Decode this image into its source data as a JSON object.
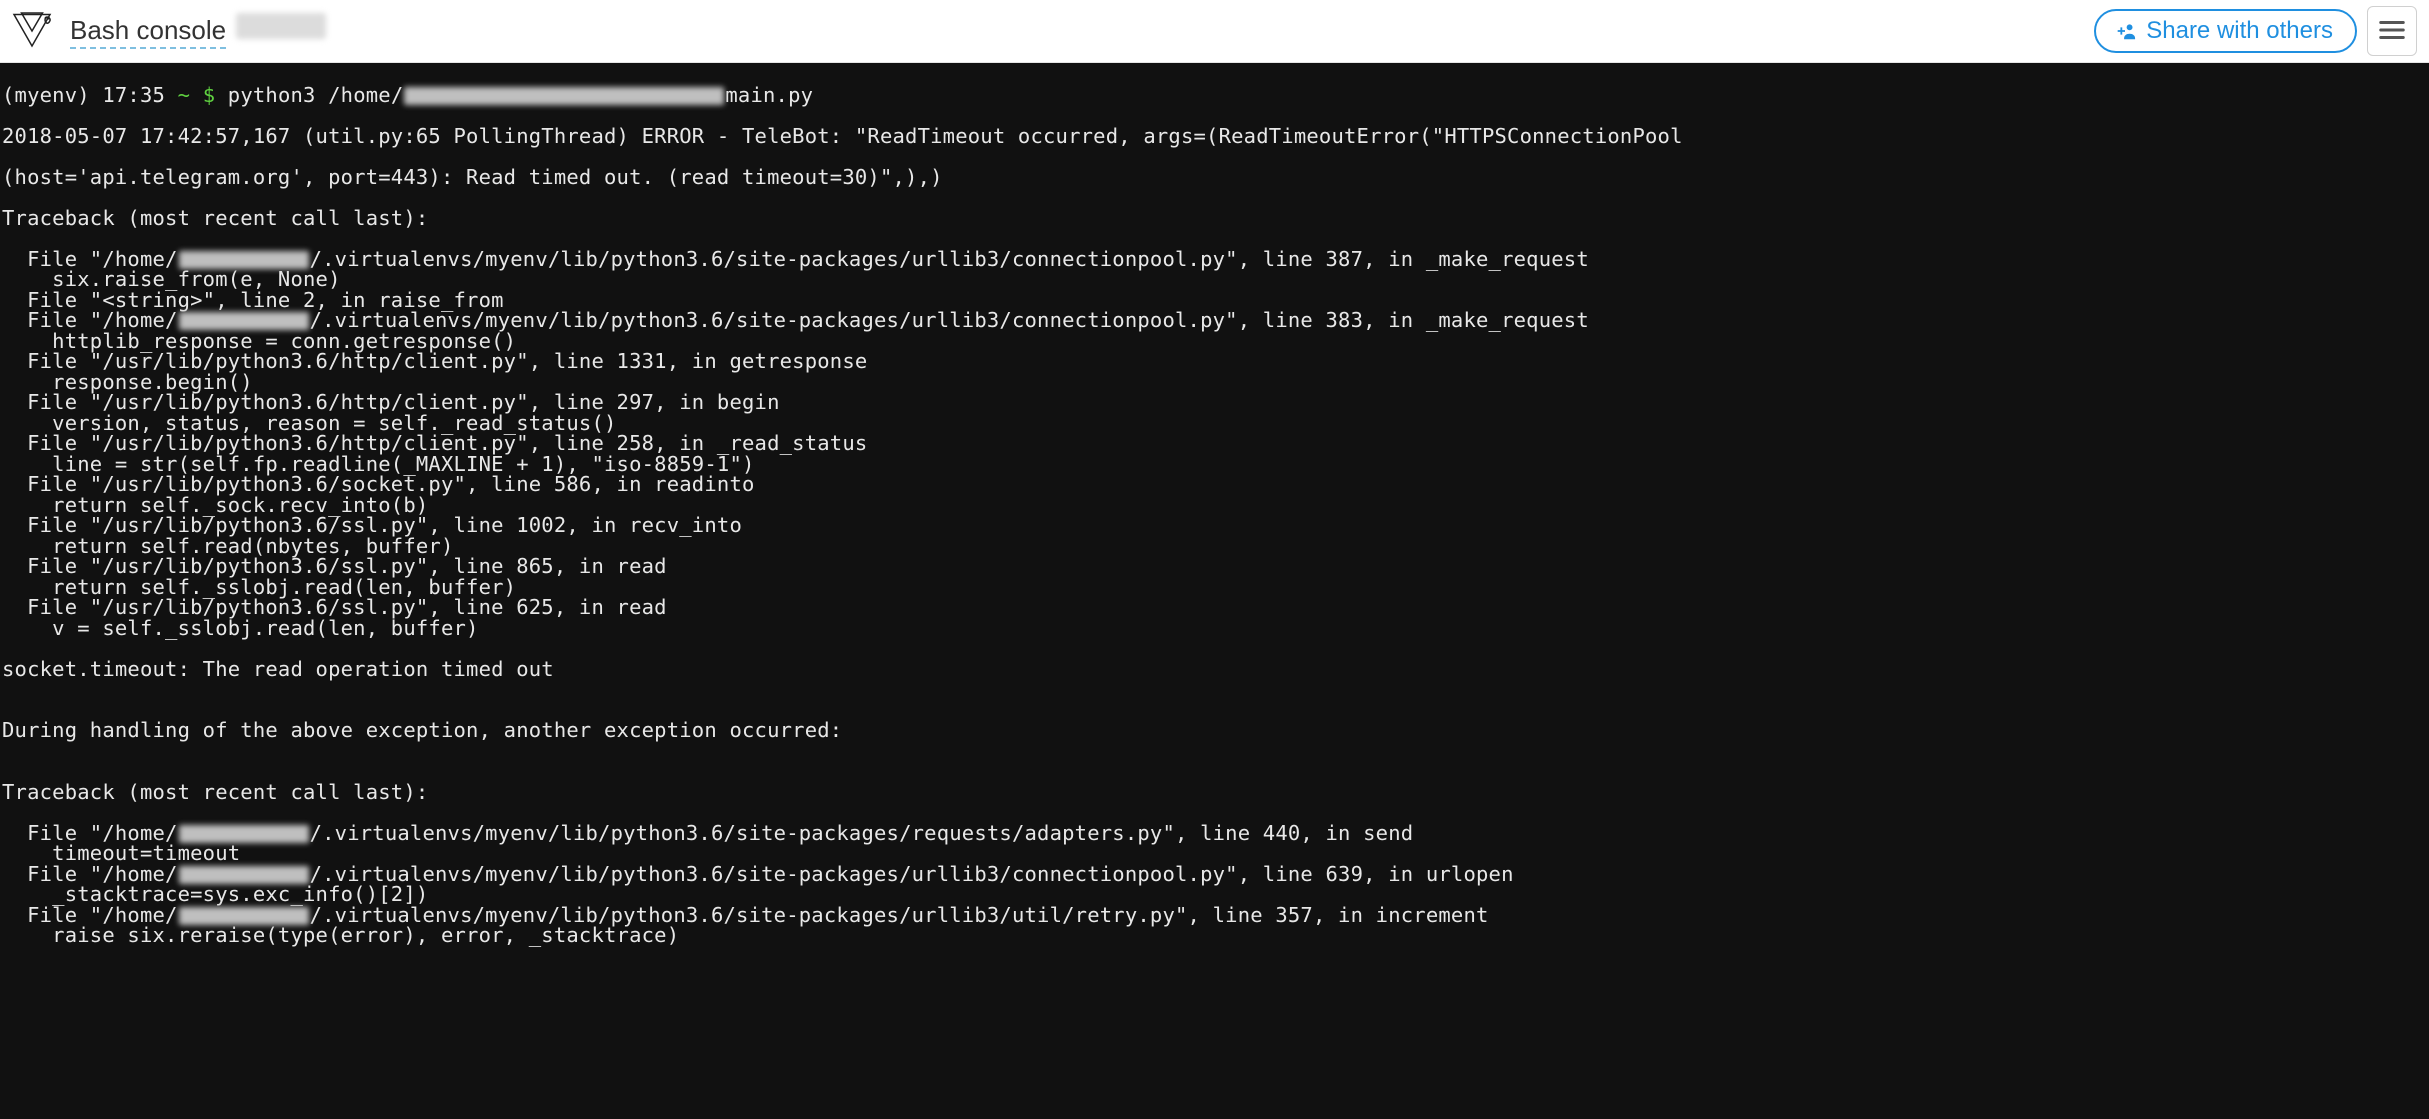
{
  "header": {
    "title": "Bash console",
    "share_label": "Share with others"
  },
  "terminal": {
    "prompt": {
      "env": "(myenv)",
      "time": "17:35",
      "tilde": "~",
      "dollar": "$",
      "cmd_pre": "python3 /home/",
      "cmd_post": "main.py"
    },
    "lines": [
      "2018-05-07 17:42:57,167 (util.py:65 PollingThread) ERROR - TeleBot: \"ReadTimeout occurred, args=(ReadTimeoutError(\"HTTPSConnectionPool",
      "(host='api.telegram.org', port=443): Read timed out. (read timeout=30)\",),)",
      "Traceback (most recent call last):"
    ],
    "frames1": [
      {
        "pre": "  File \"/home/",
        "blur": true,
        "post": "/.virtualenvs/myenv/lib/python3.6/site-packages/urllib3/connectionpool.py\", line 387, in _make_request",
        "code": "    six.raise_from(e, None)"
      },
      {
        "pre": "  File \"<string>\", line 2, in raise_from",
        "blur": false,
        "post": "",
        "code": null
      },
      {
        "pre": "  File \"/home/",
        "blur": true,
        "post": "/.virtualenvs/myenv/lib/python3.6/site-packages/urllib3/connectionpool.py\", line 383, in _make_request",
        "code": "    httplib_response = conn.getresponse()"
      },
      {
        "pre": "  File \"/usr/lib/python3.6/http/client.py\", line 1331, in getresponse",
        "blur": false,
        "post": "",
        "code": "    response.begin()"
      },
      {
        "pre": "  File \"/usr/lib/python3.6/http/client.py\", line 297, in begin",
        "blur": false,
        "post": "",
        "code": "    version, status, reason = self._read_status()"
      },
      {
        "pre": "  File \"/usr/lib/python3.6/http/client.py\", line 258, in _read_status",
        "blur": false,
        "post": "",
        "code": "    line = str(self.fp.readline(_MAXLINE + 1), \"iso-8859-1\")"
      },
      {
        "pre": "  File \"/usr/lib/python3.6/socket.py\", line 586, in readinto",
        "blur": false,
        "post": "",
        "code": "    return self._sock.recv_into(b)"
      },
      {
        "pre": "  File \"/usr/lib/python3.6/ssl.py\", line 1002, in recv_into",
        "blur": false,
        "post": "",
        "code": "    return self.read(nbytes, buffer)"
      },
      {
        "pre": "  File \"/usr/lib/python3.6/ssl.py\", line 865, in read",
        "blur": false,
        "post": "",
        "code": "    return self._sslobj.read(len, buffer)"
      },
      {
        "pre": "  File \"/usr/lib/python3.6/ssl.py\", line 625, in read",
        "blur": false,
        "post": "",
        "code": "    v = self._sslobj.read(len, buffer)"
      }
    ],
    "mid": [
      "socket.timeout: The read operation timed out",
      "",
      "During handling of the above exception, another exception occurred:",
      "",
      "Traceback (most recent call last):"
    ],
    "frames2": [
      {
        "pre": "  File \"/home/",
        "blur": true,
        "post": "/.virtualenvs/myenv/lib/python3.6/site-packages/requests/adapters.py\", line 440, in send",
        "code": "    timeout=timeout"
      },
      {
        "pre": "  File \"/home/",
        "blur": true,
        "post": "/.virtualenvs/myenv/lib/python3.6/site-packages/urllib3/connectionpool.py\", line 639, in urlopen",
        "code": "    _stacktrace=sys.exc_info()[2])"
      },
      {
        "pre": "  File \"/home/",
        "blur": true,
        "post": "/.virtualenvs/myenv/lib/python3.6/site-packages/urllib3/util/retry.py\", line 357, in increment",
        "code": "    raise six.reraise(type(error), error, _stacktrace)"
      }
    ]
  }
}
